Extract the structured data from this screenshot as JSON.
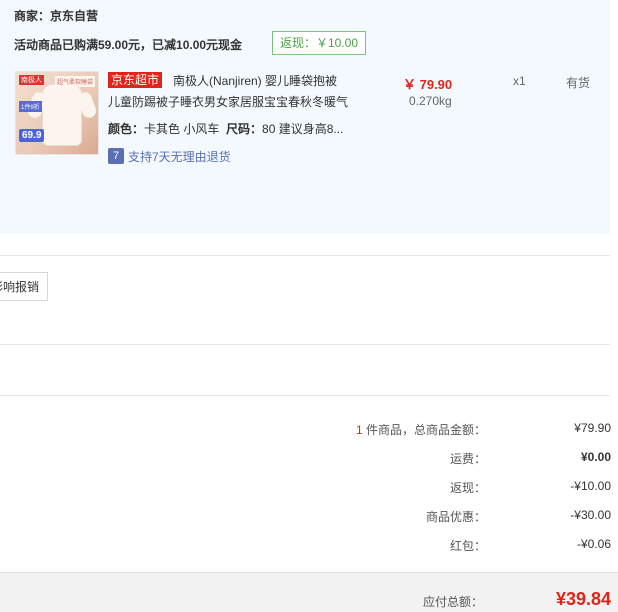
{
  "order": {
    "merchant": "商家：京东自营",
    "promo_text": "活动商品已购满59.00元，已减10.00元现金",
    "rebate_badge": "返现：￥10.00",
    "product": {
      "thumb_brand": "南极人",
      "thumb_tag": "超气柔软睡袋",
      "thumb_promo": "1件9折",
      "thumb_price": "69.9",
      "tag": "京东超市",
      "title_line1": "南极人(Nanjiren) 婴儿睡袋抱被",
      "title_line2": "儿童防踢被子睡衣男女家居服宝宝春秋冬暖气",
      "price": "￥ 79.90",
      "weight": "0.270kg",
      "quantity": "x1",
      "stock": "有货",
      "color_label": "颜色：",
      "color_value": "卡其色 小风车",
      "size_label": "尺码：",
      "size_value": "80 建议身高8...",
      "return_icon": "7",
      "return_policy": "支持7天无理由退货"
    }
  },
  "invoice": {
    "button": "影响报销"
  },
  "summary": {
    "item_count": "1",
    "items_total_label": " 件商品，总商品金额：",
    "items_total": "¥79.90",
    "shipping_label": "运费：",
    "shipping": "¥0.00",
    "rebate_label": "返现：",
    "rebate": "-¥10.00",
    "discount_label": "商品优惠：",
    "discount": "-¥30.00",
    "redpacket_label": "红包：",
    "redpacket": "-¥0.06",
    "payable_label": "应付总额：",
    "payable": "¥39.84"
  },
  "colors": {
    "accent_red": "#e2231a",
    "card_bg": "#f3f9fe",
    "green": "#4aa043",
    "link_blue": "#5a6fb4"
  },
  "icons": {
    "return": "seven-day-return-icon"
  }
}
